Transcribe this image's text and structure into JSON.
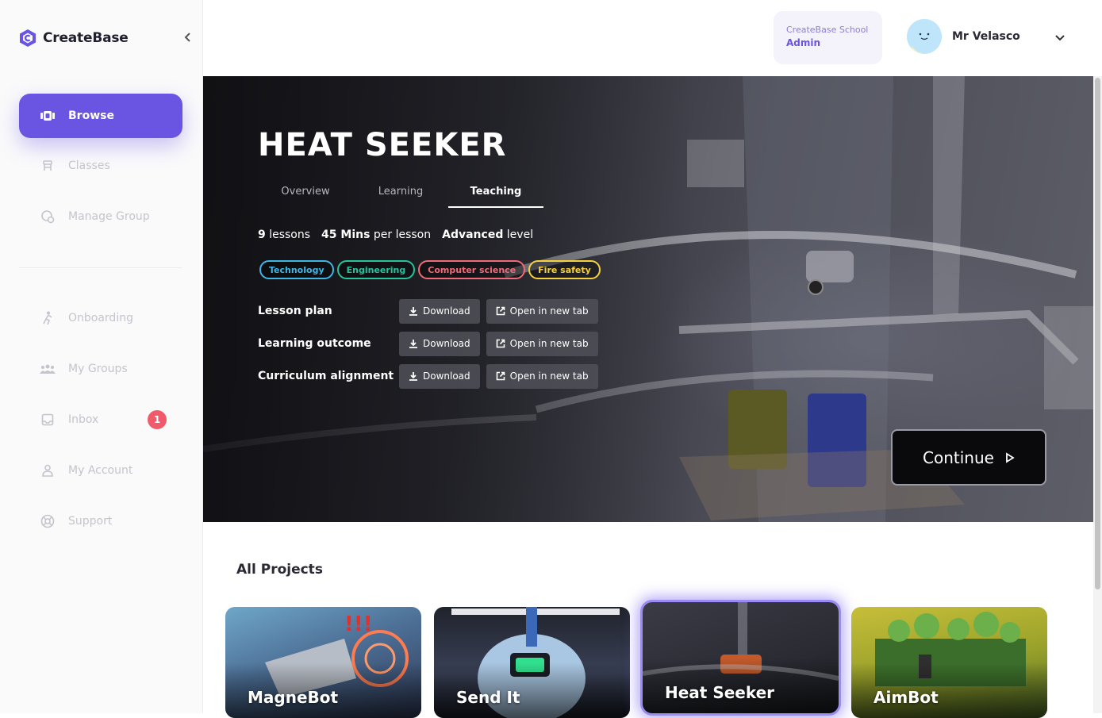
{
  "brand": {
    "name": "CreateBase"
  },
  "sidebar": {
    "items": [
      {
        "label": "Browse",
        "icon": "browse-icon",
        "active": true
      },
      {
        "label": "Classes",
        "icon": "classes-icon"
      },
      {
        "label": "Manage Group",
        "icon": "manage-group-icon"
      },
      {
        "label": "Onboarding",
        "icon": "onboarding-icon"
      },
      {
        "label": "My Groups",
        "icon": "groups-icon"
      },
      {
        "label": "Inbox",
        "icon": "inbox-icon",
        "badge": "1"
      },
      {
        "label": "My Account",
        "icon": "account-icon"
      },
      {
        "label": "Support",
        "icon": "support-icon"
      }
    ]
  },
  "header": {
    "school": "CreateBase School",
    "role": "Admin",
    "user_name": "Mr Velasco"
  },
  "hero": {
    "title": "HEAT SEEKER",
    "tabs": [
      {
        "label": "Overview"
      },
      {
        "label": "Learning"
      },
      {
        "label": "Teaching",
        "active": true
      }
    ],
    "stats": {
      "lessons_value": "9",
      "lessons_label": "lessons",
      "duration_value": "45 Mins",
      "duration_label": "per lesson",
      "level_value": "Advanced",
      "level_label": "level"
    },
    "tags": [
      {
        "label": "Technology",
        "color": "#3fb6e8"
      },
      {
        "label": "Engineering",
        "color": "#27c39a"
      },
      {
        "label": "Computer science",
        "color": "#f06a78"
      },
      {
        "label": "Fire safety",
        "color": "#f5d13d"
      }
    ],
    "resources": [
      {
        "label": "Lesson plan",
        "download": "Download",
        "open": "Open in new tab"
      },
      {
        "label": "Learning outcome",
        "download": "Download",
        "open": "Open in new tab"
      },
      {
        "label": "Curriculum alignment",
        "download": "Download",
        "open": "Open in new tab"
      }
    ],
    "continue_label": "Continue"
  },
  "projects": {
    "title": "All Projects",
    "cards": [
      {
        "name": "MagneBot"
      },
      {
        "name": "Send It"
      },
      {
        "name": "Heat Seeker",
        "selected": true
      },
      {
        "name": "AimBot"
      }
    ]
  },
  "colors": {
    "accent": "#6a55e3",
    "badge": "#ef5b6a"
  }
}
